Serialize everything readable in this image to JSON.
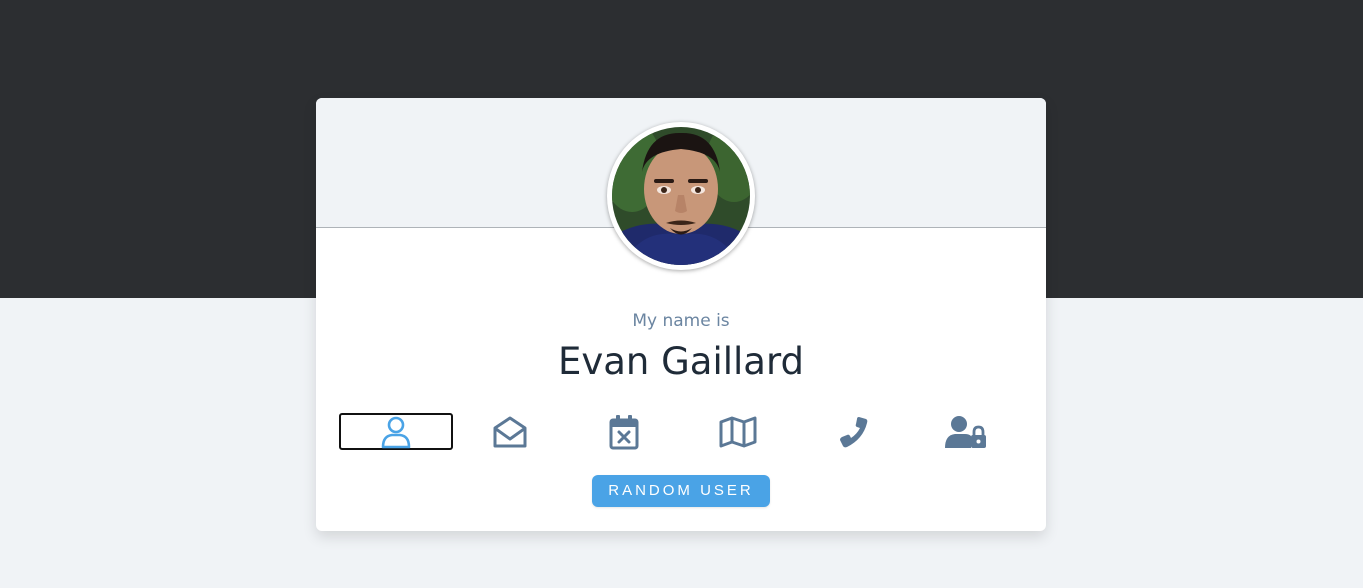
{
  "profile": {
    "label": "My name is",
    "name": "Evan Gaillard",
    "avatar_icon": "user-photo"
  },
  "icons": [
    {
      "name": "user-icon",
      "active": true
    },
    {
      "name": "envelope-icon",
      "active": false
    },
    {
      "name": "calendar-icon",
      "active": false
    },
    {
      "name": "map-icon",
      "active": false
    },
    {
      "name": "phone-icon",
      "active": false
    },
    {
      "name": "user-lock-icon",
      "active": false
    }
  ],
  "button": {
    "label": "RANDOM USER"
  },
  "colors": {
    "top_band": "#2c2e31",
    "background": "#f0f3f6",
    "icon": "#5b7896",
    "icon_active": "#4aa3e6",
    "button": "#4aa3e6",
    "name_text": "#1f2b38",
    "label_text": "#6b85a1"
  }
}
